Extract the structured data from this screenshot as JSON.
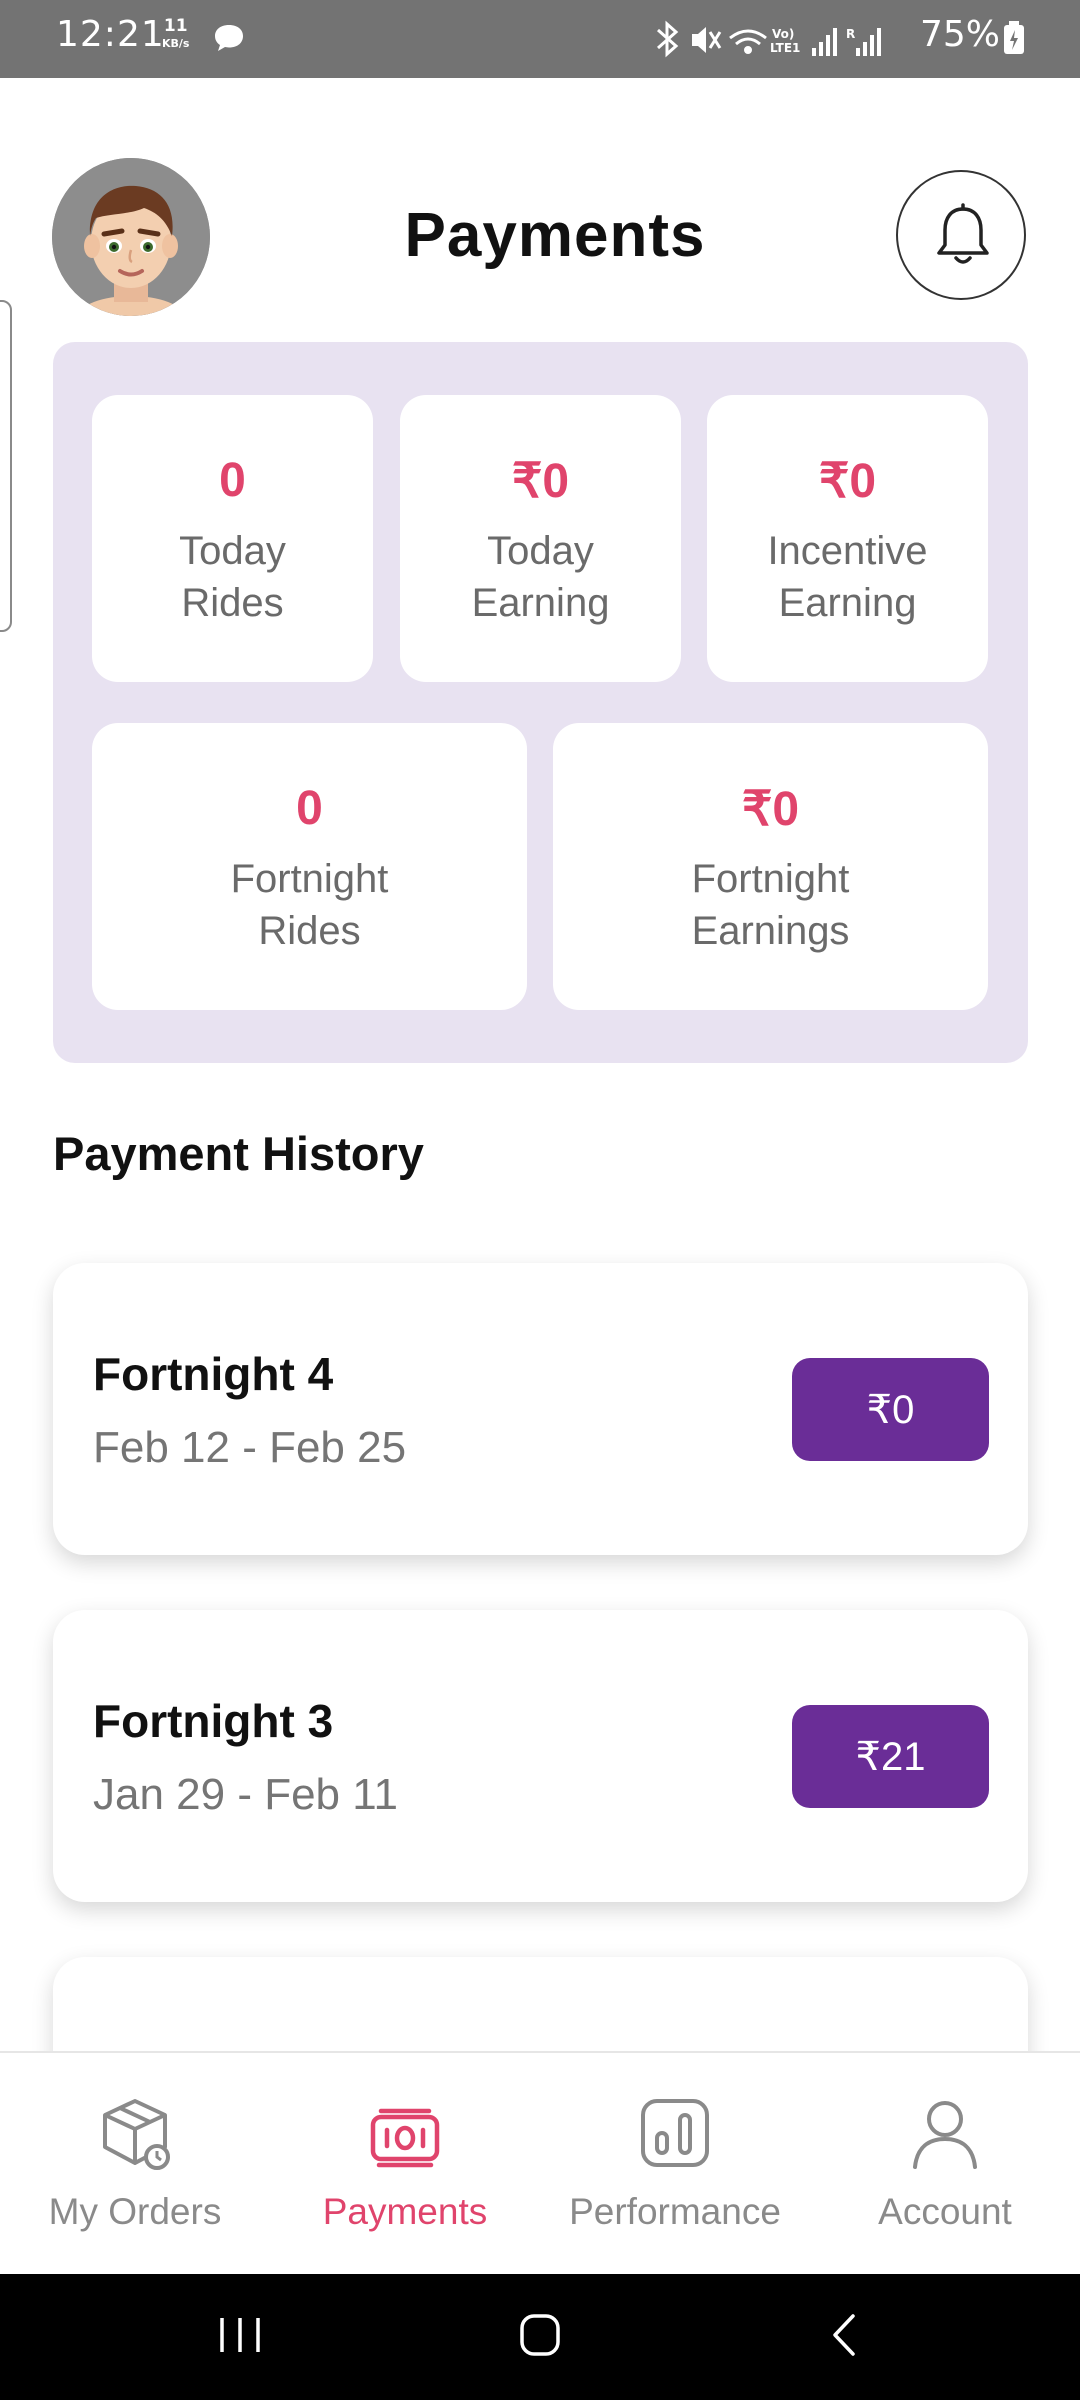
{
  "status_bar": {
    "time": "12:21",
    "speed_value": "11",
    "speed_unit": "KB/s",
    "battery": "75%"
  },
  "header": {
    "title": "Payments",
    "avatar_icon": "avatar-memoji",
    "bell_icon": "bell-icon"
  },
  "stats": {
    "today_rides": {
      "value": "0",
      "label_line1": "Today",
      "label_line2": "Rides"
    },
    "today_earning": {
      "value": "₹0",
      "label_line1": "Today",
      "label_line2": "Earning"
    },
    "incentive_earning": {
      "value": "₹0",
      "label_line1": "Incentive",
      "label_line2": "Earning"
    },
    "fortnight_rides": {
      "value": "0",
      "label_line1": "Fortnight",
      "label_line2": "Rides"
    },
    "fortnight_earnings": {
      "value": "₹0",
      "label_line1": "Fortnight",
      "label_line2": "Earnings"
    }
  },
  "history": {
    "title": "Payment History",
    "items": [
      {
        "title": "Fortnight 4",
        "dates": "Feb 12 - Feb 25",
        "amount": "₹0"
      },
      {
        "title": "Fortnight 3",
        "dates": "Jan 29 - Feb 11",
        "amount": "₹21"
      }
    ]
  },
  "bottom_nav": {
    "items": [
      {
        "label": "My Orders",
        "icon": "box-icon"
      },
      {
        "label": "Payments",
        "icon": "payments-icon",
        "active": true
      },
      {
        "label": "Performance",
        "icon": "chart-icon"
      },
      {
        "label": "Account",
        "icon": "person-icon"
      }
    ]
  },
  "colors": {
    "accent": "#e0446c",
    "purple": "#6a2d97",
    "panel": "#e8e2f1"
  }
}
